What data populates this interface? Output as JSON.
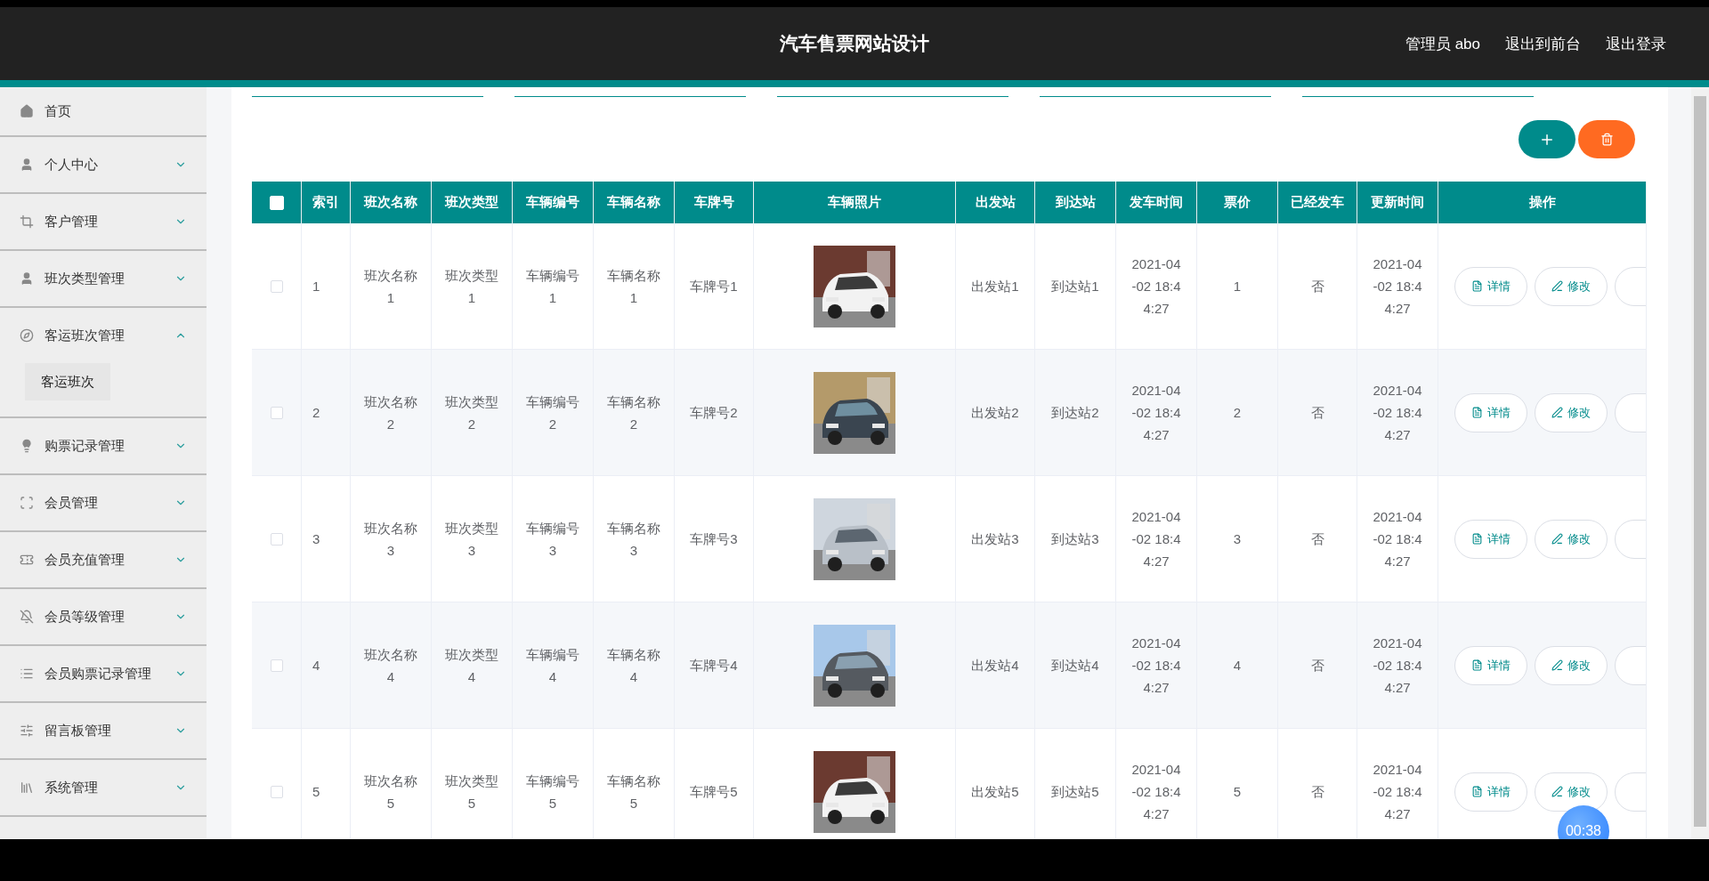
{
  "header": {
    "title": "汽车售票网站设计",
    "user": "管理员 abo",
    "links": [
      "退出到前台",
      "退出登录"
    ]
  },
  "sidebar": {
    "items": [
      {
        "label": "首页",
        "kind": "link"
      },
      {
        "label": "个人中心",
        "kind": "menu",
        "expanded": false
      },
      {
        "label": "客户管理",
        "kind": "menu",
        "expanded": false
      },
      {
        "label": "班次类型管理",
        "kind": "menu",
        "expanded": false
      },
      {
        "label": "客运班次管理",
        "kind": "menu",
        "expanded": true,
        "children": [
          {
            "label": "客运班次",
            "selected": true
          }
        ]
      },
      {
        "label": "购票记录管理",
        "kind": "menu",
        "expanded": false
      },
      {
        "label": "会员管理",
        "kind": "menu",
        "expanded": false
      },
      {
        "label": "会员充值管理",
        "kind": "menu",
        "expanded": false
      },
      {
        "label": "会员等级管理",
        "kind": "menu",
        "expanded": false
      },
      {
        "label": "会员购票记录管理",
        "kind": "menu",
        "expanded": false
      },
      {
        "label": "留言板管理",
        "kind": "menu",
        "expanded": false
      },
      {
        "label": "系统管理",
        "kind": "menu",
        "expanded": false
      }
    ]
  },
  "table": {
    "select_all": {
      "checked": false
    },
    "columns": [
      {
        "kind": "check"
      },
      {
        "kind": "text",
        "label": "索引"
      },
      {
        "kind": "text",
        "label": "班次名称"
      },
      {
        "kind": "text",
        "label": "班次类型"
      },
      {
        "kind": "text",
        "label": "车辆编号"
      },
      {
        "kind": "text",
        "label": "车辆名称"
      },
      {
        "kind": "text",
        "label": "车牌号"
      },
      {
        "label": "车辆照片"
      },
      {
        "kind": "text",
        "label": "出发站"
      },
      {
        "kind": "text",
        "label": "到达站"
      },
      {
        "kind": "text",
        "label": "发车时间"
      },
      {
        "kind": "text",
        "label": "票价"
      },
      {
        "kind": "text",
        "label": "已经发车"
      },
      {
        "kind": "text",
        "label": "更新时间"
      },
      {
        "kind": "actions",
        "label": "操作"
      }
    ],
    "rows": [
      {
        "checked": false,
        "cells": [
          "",
          "1",
          "班次名称1",
          "班次类型1",
          "车辆编号1",
          "车辆名称1",
          "车牌号1",
          "",
          "出发站1",
          "到达站1",
          "2021-04-02 18:44:27",
          "1",
          "否",
          "2021-04-02 18:44:27",
          ""
        ],
        "actions": [
          "详情",
          "修改"
        ]
      },
      {
        "checked": false,
        "cells": [
          "",
          "2",
          "班次名称2",
          "班次类型2",
          "车辆编号2",
          "车辆名称2",
          "车牌号2",
          "",
          "出发站2",
          "到达站2",
          "2021-04-02 18:44:27",
          "2",
          "否",
          "2021-04-02 18:44:27",
          ""
        ],
        "actions": [
          "详情",
          "修改"
        ]
      },
      {
        "checked": false,
        "cells": [
          "",
          "3",
          "班次名称3",
          "班次类型3",
          "车辆编号3",
          "车辆名称3",
          "车牌号3",
          "",
          "出发站3",
          "到达站3",
          "2021-04-02 18:44:27",
          "3",
          "否",
          "2021-04-02 18:44:27",
          ""
        ],
        "actions": [
          "详情",
          "修改"
        ]
      },
      {
        "checked": false,
        "cells": [
          "",
          "4",
          "班次名称4",
          "班次类型4",
          "车辆编号4",
          "车辆名称4",
          "车牌号4",
          "",
          "出发站4",
          "到达站4",
          "2021-04-02 18:44:27",
          "4",
          "否",
          "2021-04-02 18:44:27",
          ""
        ],
        "actions": [
          "详情",
          "修改"
        ]
      },
      {
        "checked": false,
        "cells": [
          "",
          "5",
          "班次名称5",
          "班次类型5",
          "车辆编号5",
          "车辆名称5",
          "车牌号5",
          "",
          "出发站5",
          "到达站5",
          "2021-04-02 18:44:27",
          "5",
          "否",
          "2021-04-02 18:44:27",
          ""
        ],
        "actions": [
          "详情",
          "修改"
        ]
      }
    ]
  },
  "timer": "00:38"
}
